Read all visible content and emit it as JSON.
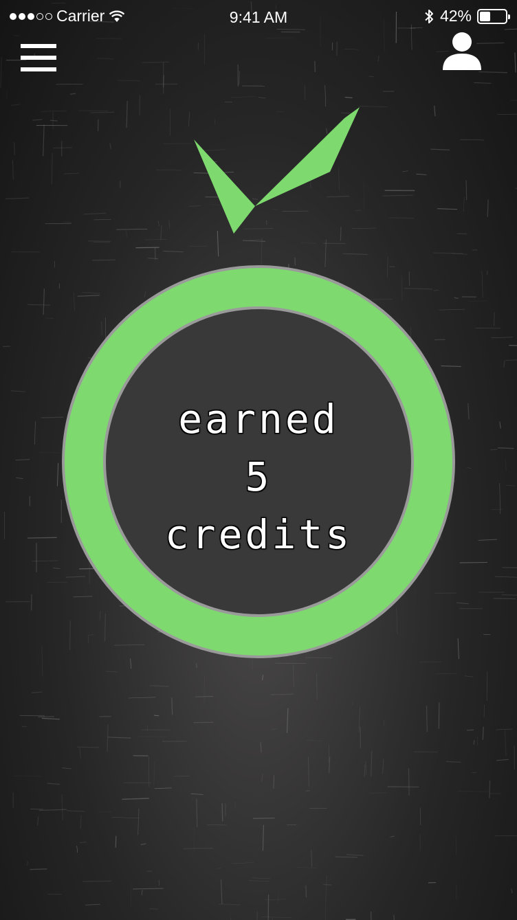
{
  "status_bar": {
    "carrier": "Carrier",
    "time": "9:41 AM",
    "battery_percent": "42%",
    "battery_level": 0.42,
    "signal_bars_filled": 3,
    "signal_bars_total": 5
  },
  "nav": {
    "menu_icon": "hamburger-menu-icon",
    "profile_icon": "user-profile-icon"
  },
  "result": {
    "line1": "earned",
    "credits_value": "5",
    "line3": "credits",
    "accent_color": "#7ed96f",
    "ring_border_color": "#9a9a9a"
  }
}
